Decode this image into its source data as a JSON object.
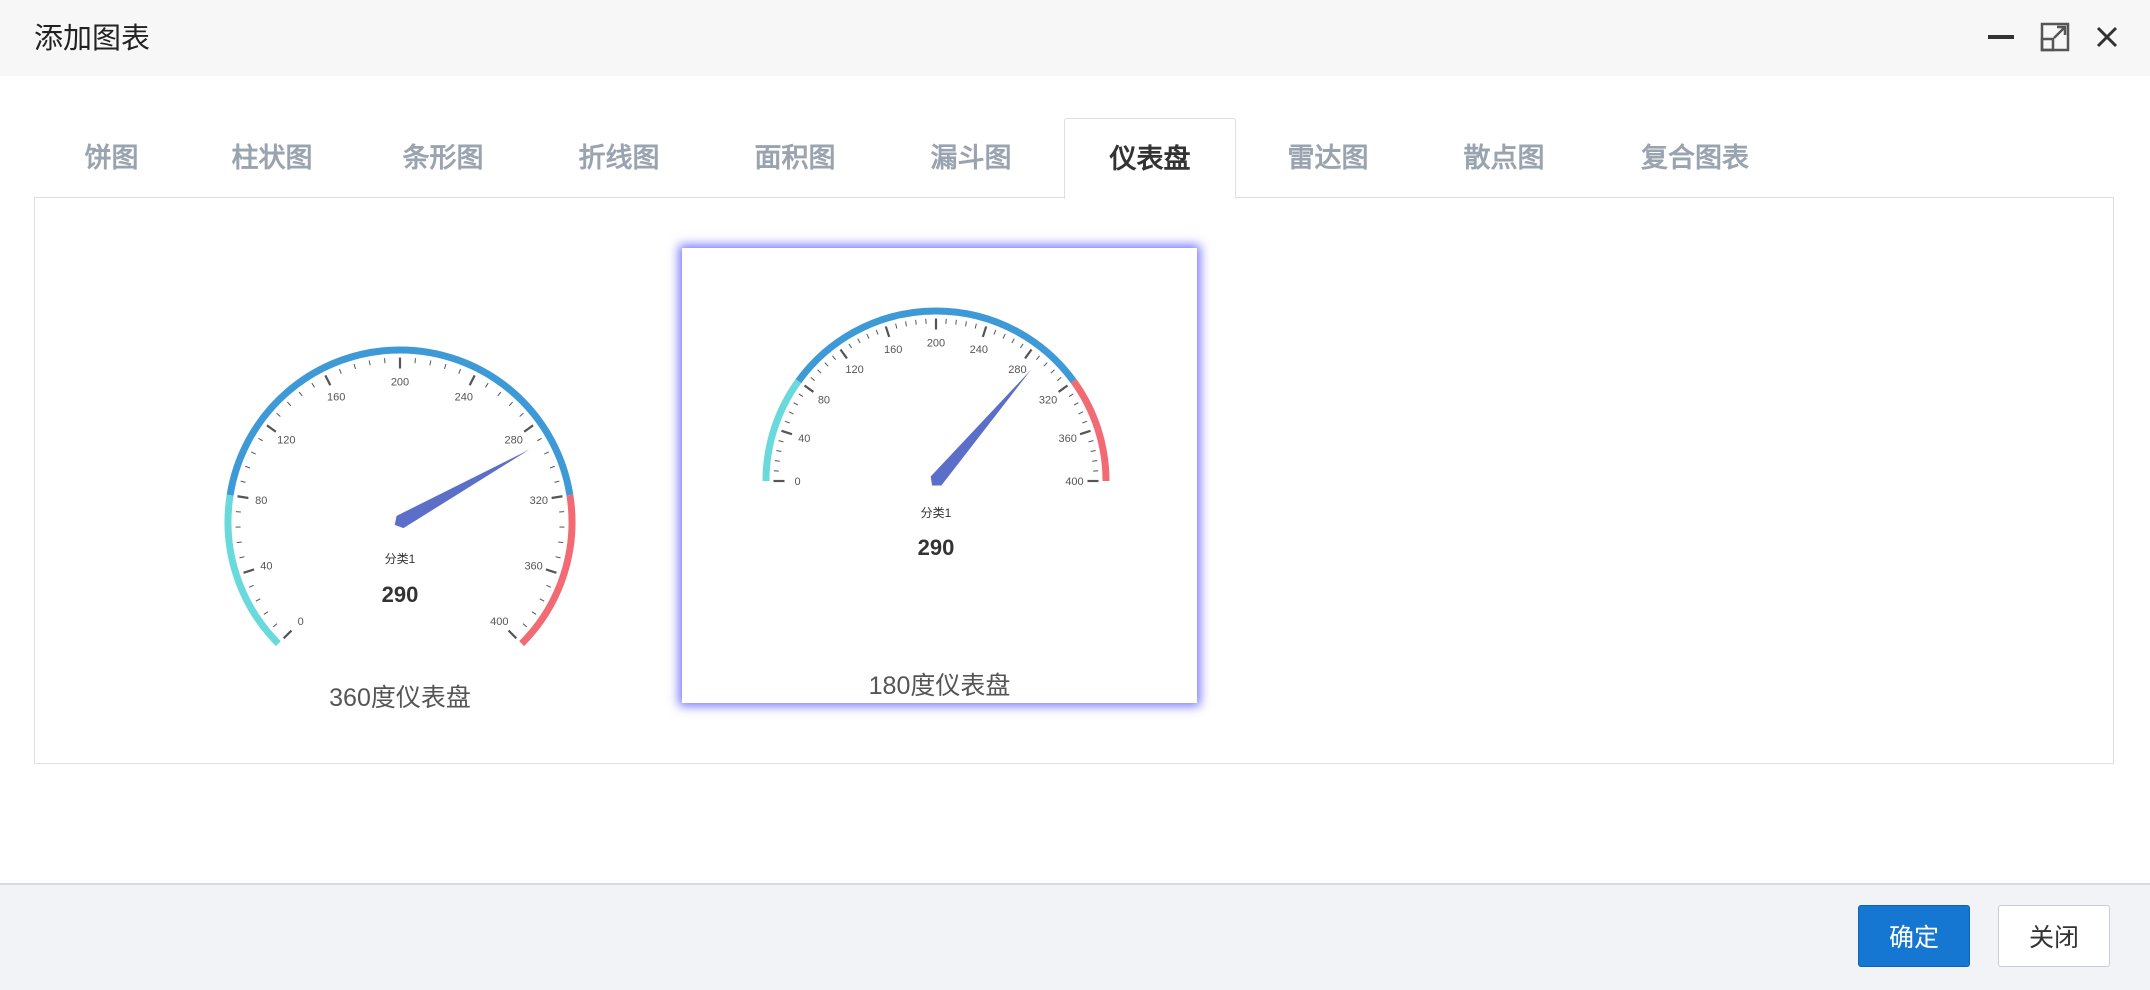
{
  "window": {
    "title": "添加图表"
  },
  "tabs": [
    {
      "label": "饼图"
    },
    {
      "label": "柱状图"
    },
    {
      "label": "条形图"
    },
    {
      "label": "折线图"
    },
    {
      "label": "面积图"
    },
    {
      "label": "漏斗图"
    },
    {
      "label": "仪表盘",
      "active": true
    },
    {
      "label": "雷达图"
    },
    {
      "label": "散点图"
    },
    {
      "label": "复合图表"
    }
  ],
  "cards": [
    {
      "label": "360度仪表盘",
      "selected": false
    },
    {
      "label": "180度仪表盘",
      "selected": true
    }
  ],
  "chart_data": [
    {
      "type": "gauge",
      "variant": "360",
      "min": 0,
      "max": 400,
      "tick_labels": [
        "0",
        "40",
        "80",
        "120",
        "160",
        "200",
        "240",
        "280",
        "320",
        "360",
        "400"
      ],
      "value": 290,
      "value_label": "290",
      "category_label": "分类1",
      "color_bands": [
        {
          "to": 0.2,
          "color": "#6ad9dc"
        },
        {
          "to": 0.8,
          "color": "#3d9ad6"
        },
        {
          "to": 1.0,
          "color": "#f26b74"
        }
      ],
      "pointer_color": "#5b6ec8"
    },
    {
      "type": "gauge",
      "variant": "180",
      "min": 0,
      "max": 400,
      "tick_labels": [
        "0",
        "40",
        "80",
        "120",
        "160",
        "200",
        "240",
        "280",
        "320",
        "360",
        "400"
      ],
      "value": 290,
      "value_label": "290",
      "category_label": "分类1",
      "color_bands": [
        {
          "to": 0.2,
          "color": "#6ad9dc"
        },
        {
          "to": 0.8,
          "color": "#3d9ad6"
        },
        {
          "to": 1.0,
          "color": "#f26b74"
        }
      ],
      "pointer_color": "#5b6ec8"
    }
  ],
  "footer": {
    "confirm_label": "确定",
    "close_label": "关闭"
  }
}
